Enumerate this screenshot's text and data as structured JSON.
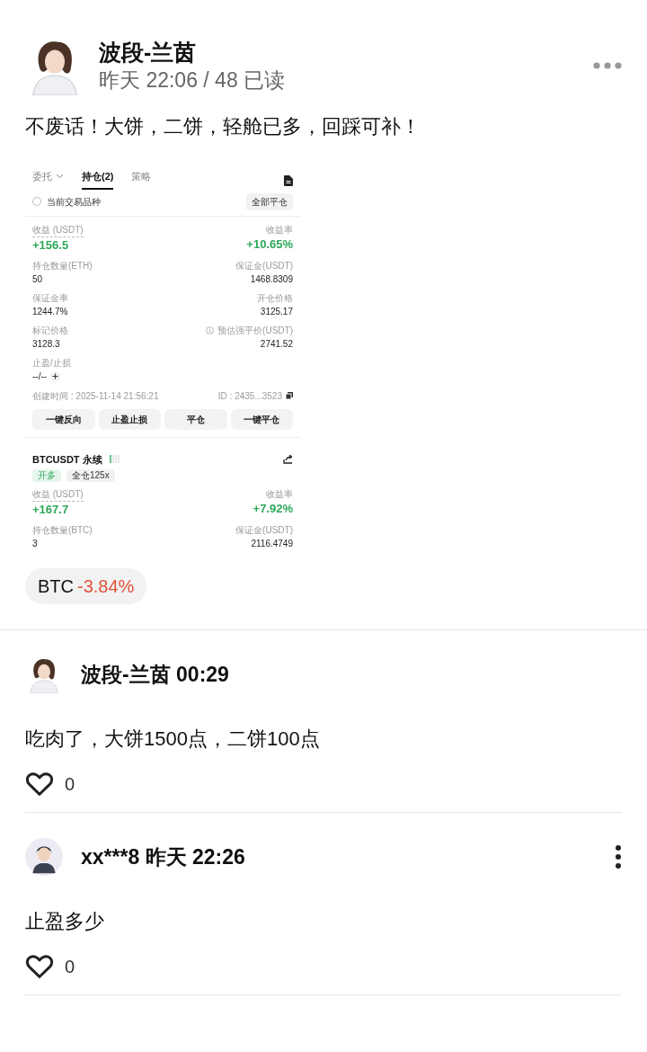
{
  "post": {
    "author": "波段-兰茵",
    "meta": "昨天 22:06 / 48 已读",
    "text": "不废话！大饼，二饼，轻舱已多，回踩可补！",
    "screenshot": {
      "tabs": [
        {
          "label": "委托",
          "selected": false,
          "dropdown": true
        },
        {
          "label": "持仓(2)",
          "selected": true,
          "dropdown": false
        },
        {
          "label": "策略",
          "selected": false,
          "dropdown": false
        }
      ],
      "filter": {
        "label": "当前交易品种",
        "checked": false
      },
      "close_all": "全部平仓",
      "positions": [
        {
          "rows": [
            {
              "kind": "pnl",
              "left": {
                "label": "收益 (USDT)",
                "value": "+156.5"
              },
              "right": {
                "label": "收益率",
                "value": "+10.65%"
              }
            },
            {
              "kind": "plain",
              "left": {
                "label": "持仓数量(ETH)",
                "value": "50"
              },
              "right": {
                "label": "保证金(USDT)",
                "value": "1468.8309"
              }
            },
            {
              "kind": "plain",
              "left": {
                "label": "保证金率",
                "value": "1244.7%"
              },
              "right": {
                "label": "开仓价格",
                "value": "3125.17"
              }
            },
            {
              "kind": "plain",
              "left": {
                "label": "标记价格",
                "value": "3128.3"
              },
              "right": {
                "label": "预估强平价(USDT)",
                "value": "2741.52",
                "info": true
              }
            }
          ],
          "tpsl": {
            "label": "止盈/止损",
            "value": "--/--"
          },
          "created": "创建时间 : 2025-11-14 21:56:21",
          "id": "ID : 2435...3523",
          "actions": [
            "一键反向",
            "止盈止损",
            "平仓",
            "一键平仓"
          ]
        },
        {
          "title": "BTCUSDT 永续",
          "tags": [
            {
              "label": "开多",
              "kind": "long"
            },
            {
              "label": "全仓125x",
              "kind": "plain"
            }
          ],
          "rows": [
            {
              "kind": "pnl",
              "left": {
                "label": "收益 (USDT)",
                "value": "+167.7"
              },
              "right": {
                "label": "收益率",
                "value": "+7.92%"
              }
            },
            {
              "kind": "plain",
              "left": {
                "label": "持仓数量(BTC)",
                "value": "3"
              },
              "right": {
                "label": "保证金(USDT)",
                "value": "2116.4749"
              }
            }
          ]
        }
      ]
    },
    "tag": {
      "symbol": "BTC",
      "change": "-3.84%"
    }
  },
  "comments": [
    {
      "avatar": {
        "kind": "woman"
      },
      "author": "波段-兰茵 00:29",
      "text": "吃肉了，大饼1500点，二饼100点",
      "likes": "0",
      "menu": false
    },
    {
      "avatar": {
        "kind": "man"
      },
      "author": "xx***8 昨天 22:26",
      "text": "止盈多少",
      "likes": "0",
      "menu": true
    }
  ]
}
